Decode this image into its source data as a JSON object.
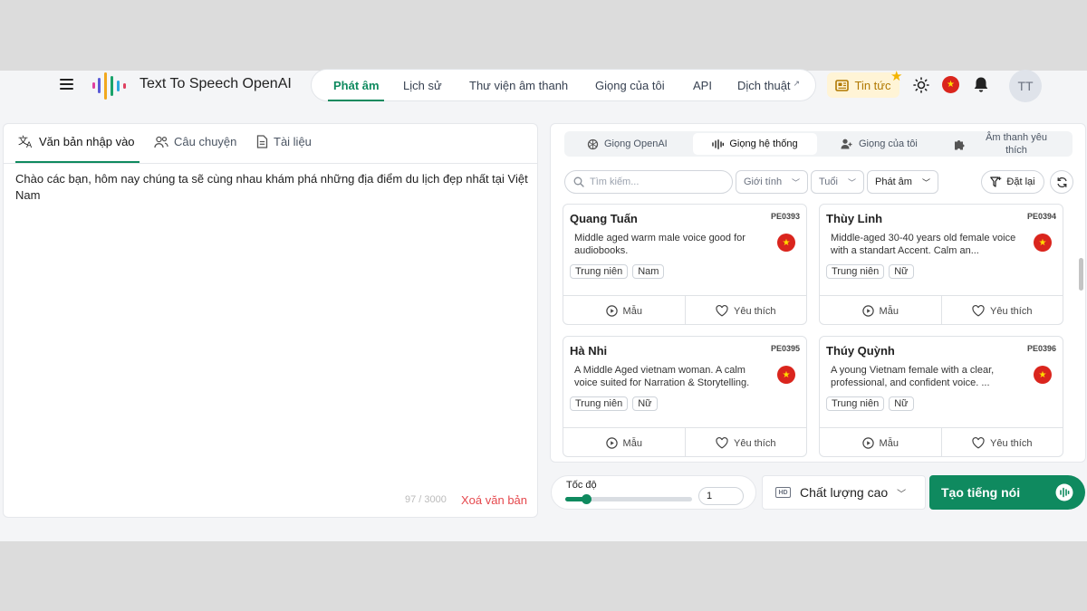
{
  "header": {
    "brand": "Text To Speech OpenAI",
    "nav": [
      {
        "label": "Phát âm",
        "active": true
      },
      {
        "label": "Lịch sử"
      },
      {
        "label": "Thư viện âm thanh"
      },
      {
        "label": "Giọng của tôi"
      },
      {
        "label": "API"
      },
      {
        "label": "Dịch thuật",
        "external": true
      }
    ],
    "news_label": "Tin tức",
    "avatar_initials": "TT",
    "icons": [
      "menu-icon",
      "sun-icon",
      "vietnam-flag-icon",
      "bell-icon"
    ]
  },
  "left_panel": {
    "tabs": [
      {
        "label": "Văn bản nhập vào",
        "icon": "translate-icon",
        "active": true
      },
      {
        "label": "Câu chuyện",
        "icon": "people-icon"
      },
      {
        "label": "Tài liệu",
        "icon": "document-icon"
      }
    ],
    "text": "Chào các bạn, hôm nay chúng ta sẽ cùng nhau khám phá những địa điểm du lịch đẹp nhất tại Việt Nam",
    "char_count": "97 / 3000",
    "clear_label": "Xoá văn bản"
  },
  "right_panel": {
    "voice_tabs": [
      {
        "label": "Giọng OpenAI",
        "icon": "openai-icon"
      },
      {
        "label": "Giọng hệ thống",
        "icon": "waveform-icon",
        "active": true
      },
      {
        "label": "Giọng của tôi",
        "icon": "user-icon"
      },
      {
        "label": "Âm thanh yêu thích",
        "icon": "puzzle-icon"
      }
    ],
    "search_placeholder": "Tìm kiếm...",
    "filters": {
      "gender": "Giới tính",
      "age": "Tuổi",
      "pronunciation": "Phát âm"
    },
    "reset_label": "Đặt lại",
    "voices": [
      {
        "name": "Quang Tuấn",
        "code": "PE0393",
        "description": "Middle aged warm male voice good for audiobooks.",
        "tags": [
          "Trung niên",
          "Nam"
        ],
        "sample_label": "Mẫu",
        "favorite_label": "Yêu thích"
      },
      {
        "name": "Thùy Linh",
        "code": "PE0394",
        "description": "Middle-aged 30-40 years old female voice with a standart Accent. Calm an...",
        "tags": [
          "Trung niên",
          "Nữ"
        ],
        "sample_label": "Mẫu",
        "favorite_label": "Yêu thích"
      },
      {
        "name": "Hà Nhi",
        "code": "PE0395",
        "description": "A Middle Aged vietnam woman. A calm voice suited for Narration & Storytelling.",
        "tags": [
          "Trung niên",
          "Nữ"
        ],
        "sample_label": "Mẫu",
        "favorite_label": "Yêu thích"
      },
      {
        "name": "Thúy Quỳnh",
        "code": "PE0396",
        "description": "A young Vietnam female with a clear, professional, and confident voice. ...",
        "tags": [
          "Trung niên",
          "Nữ"
        ],
        "sample_label": "Mẫu",
        "favorite_label": "Yêu thích"
      }
    ]
  },
  "bottom_bar": {
    "speed_label": "Tốc độ",
    "speed_value": "1",
    "speed_level": 0.12,
    "quality_label": "Chất lượng cao",
    "generate_label": "Tạo tiếng nói"
  },
  "colors": {
    "accent": "#0f8a5f",
    "danger": "#e5484d",
    "news_bg": "#fff4d6"
  }
}
